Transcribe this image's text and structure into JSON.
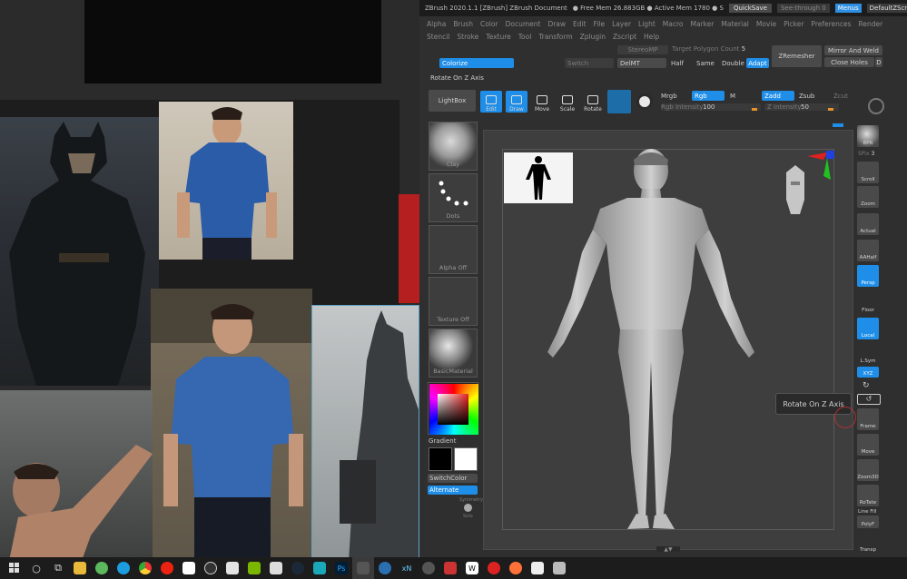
{
  "window": {
    "title": "ZBrush 2020.1.1 [ZBrush]   ZBrush Document",
    "mem": "● Free Mem 26.883GB ● Active Mem 1780 ● S",
    "quicksave": "QuickSave",
    "see_through": "See-through",
    "see_through_value": "0",
    "menus": "Menus",
    "default_script": "DefaultZScript"
  },
  "menu_row1": [
    "Alpha",
    "Brush",
    "Color",
    "Document",
    "Draw",
    "Edit",
    "File",
    "Layer",
    "Light",
    "Macro",
    "Marker",
    "Material",
    "Movie",
    "Picker",
    "Preferences",
    "Render"
  ],
  "menu_row2": [
    "Stencil",
    "Stroke",
    "Texture",
    "Tool",
    "Transform",
    "Zplugin",
    "Zscript",
    "Help"
  ],
  "toolbar": {
    "stereo_mp": "StereoMP",
    "target_poly": "Target Polygon Count",
    "target_poly_value": "5",
    "zremesher": "ZRemesher",
    "mirror_weld": "Mirror And Weld",
    "close_holes": "Close Holes",
    "d": "D",
    "colorize": "Colorize",
    "switch": "Switch",
    "delmt": "DelMT",
    "half": "Half",
    "same": "Same",
    "double": "Double",
    "adapt": "Adapt",
    "rotate_z": "Rotate On Z Axis",
    "lightbox": "LightBox",
    "edit": "Edit",
    "draw": "Draw",
    "move": "Move",
    "scale": "Scale",
    "rotate": "Rotate",
    "mrgb": "Mrgb",
    "rgb": "Rgb",
    "m": "M",
    "rgb_intensity": "Rgb Intensity",
    "rgb_intensity_value": "100",
    "zadd": "Zadd",
    "zsub": "Zsub",
    "zcut": "Zcut",
    "z_intensity": "Z Intensity",
    "z_intensity_value": "50"
  },
  "tray": {
    "clay": "Clay",
    "dots": "Dots",
    "alpha_off": "Alpha Off",
    "texture_off": "Texture Off",
    "basic_material": "BasicMaterial",
    "gradient": "Gradient",
    "switch_color": "SwitchColor",
    "alternate": "Alternate",
    "symmetry": "Symmetry",
    "solo": "Solo"
  },
  "canvas": {
    "tooltip": "Rotate On Z Axis"
  },
  "shelf": {
    "bpr": "BPR",
    "spix": "SPix",
    "spix_value": "3",
    "scroll": "Scroll",
    "zoom": "Zoom",
    "actual": "Actual",
    "aahalf": "AAHalf",
    "persp": "Persp",
    "floor": "Floor",
    "local": "Local",
    "lsym": "L.Sym",
    "xyz": "XYZ",
    "frame": "Frame",
    "move": "Move",
    "zoom3d": "Zoom3D",
    "rotate": "RoTate",
    "line_fill": "Line Fill",
    "polyf": "PolyF",
    "transp": "Transp"
  },
  "taskbar": [
    "start",
    "search",
    "task-view",
    "file-explorer",
    "utorrent",
    "skype",
    "chrome",
    "opera",
    "vlc",
    "obs",
    "gmail",
    "nvidia",
    "steam-like",
    "brush",
    "maya",
    "photoshop",
    "zbrush",
    "app",
    "xn",
    "capture",
    "wps",
    "word",
    "app",
    "firefox",
    "movies",
    "window"
  ],
  "colors": {
    "accent": "#1f8ee8",
    "orange": "#e8922a",
    "red": "#b51f1f"
  }
}
